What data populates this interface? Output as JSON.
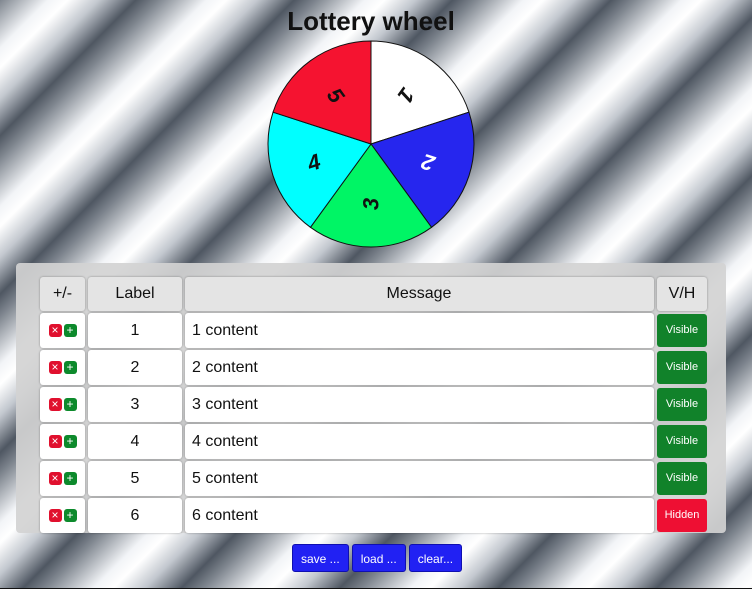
{
  "title": "Lottery wheel",
  "wheel": {
    "segments": [
      {
        "label": "1",
        "color": "#ffffff"
      },
      {
        "label": "2",
        "color": "#2626ee"
      },
      {
        "label": "3",
        "color": "#00f565"
      },
      {
        "label": "4",
        "color": "#00ffff"
      },
      {
        "label": "5",
        "color": "#f51330"
      }
    ]
  },
  "table": {
    "headers": {
      "pm": "+/-",
      "label": "Label",
      "message": "Message",
      "vh": "V/H"
    },
    "rows": [
      {
        "label": "1",
        "message": "1 content",
        "visibility": "Visible",
        "visible": true
      },
      {
        "label": "2",
        "message": "2 content",
        "visibility": "Visible",
        "visible": true
      },
      {
        "label": "3",
        "message": "3 content",
        "visibility": "Visible",
        "visible": true
      },
      {
        "label": "4",
        "message": "4 content",
        "visibility": "Visible",
        "visible": true
      },
      {
        "label": "5",
        "message": "5 content",
        "visibility": "Visible",
        "visible": true
      },
      {
        "label": "6",
        "message": "6 content",
        "visibility": "Hidden",
        "visible": false
      }
    ],
    "remove_icon": "×",
    "add_icon": "+"
  },
  "buttons": {
    "save": "save ...",
    "load": "load ...",
    "clear": "clear..."
  },
  "colors": {
    "button": "#2121f3",
    "visible": "#11822a",
    "hidden": "#ee0f33"
  }
}
